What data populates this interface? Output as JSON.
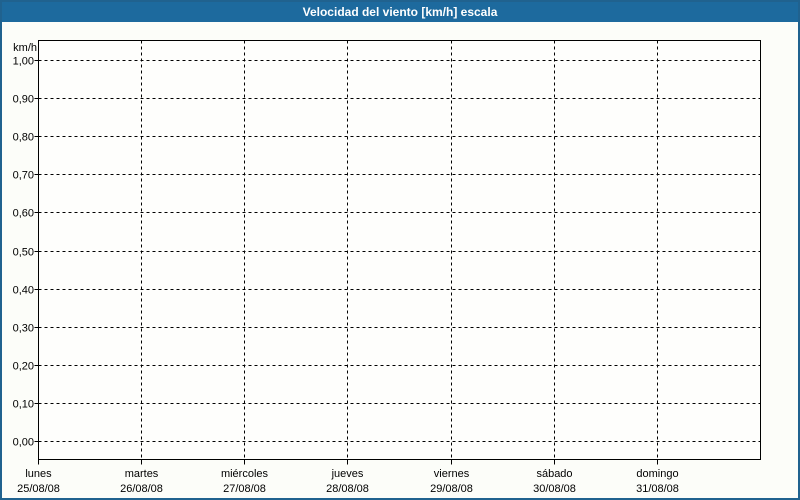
{
  "window": {
    "title": "Velocidad del viento [km/h] escala"
  },
  "colors": {
    "titlebar-bg": "#1d6a9e",
    "titlebar-text": "#ffffff",
    "frame-border": "#20628f",
    "page-bg": "#fcfdf9",
    "plot-bg": "#fefefc",
    "grid-line": "#000000",
    "axis-text": "#000000"
  },
  "chart_data": {
    "type": "line",
    "title": "Velocidad del viento [km/h] escala",
    "xlabel": "",
    "ylabel": "km/h",
    "ylim": [
      -0.05,
      1.05
    ],
    "grid": "dashed",
    "legend": "none",
    "y_ticks": [
      {
        "label": "1,00",
        "value": 1.0
      },
      {
        "label": "0,90",
        "value": 0.9
      },
      {
        "label": "0,80",
        "value": 0.8
      },
      {
        "label": "0,70",
        "value": 0.7
      },
      {
        "label": "0,60",
        "value": 0.6
      },
      {
        "label": "0,50",
        "value": 0.5
      },
      {
        "label": "0,40",
        "value": 0.4
      },
      {
        "label": "0,30",
        "value": 0.3
      },
      {
        "label": "0,20",
        "value": 0.2
      },
      {
        "label": "0,10",
        "value": 0.1
      },
      {
        "label": "0,00",
        "value": 0.0
      }
    ],
    "x_categories": [
      {
        "day": "lunes",
        "date": "25/08/08"
      },
      {
        "day": "martes",
        "date": "26/08/08"
      },
      {
        "day": "miércoles",
        "date": "27/08/08"
      },
      {
        "day": "jueves",
        "date": "28/08/08"
      },
      {
        "day": "viernes",
        "date": "29/08/08"
      },
      {
        "day": "sábado",
        "date": "30/08/08"
      },
      {
        "day": "domingo",
        "date": "31/08/08"
      }
    ],
    "series": []
  }
}
